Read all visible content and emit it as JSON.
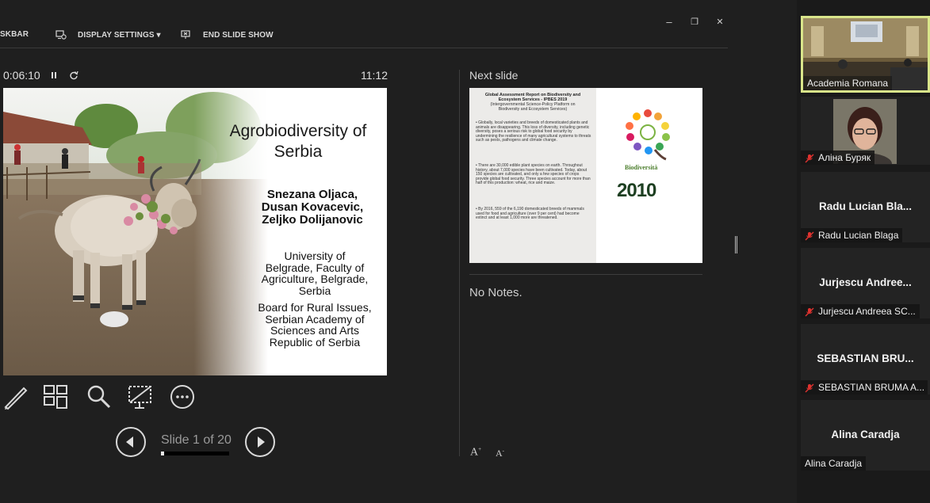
{
  "toolbar": {
    "taskbar_label": "SKBAR",
    "display_settings_label": "DISPLAY SETTINGS ▾",
    "end_slide_show_label": "END SLIDE SHOW"
  },
  "window_controls": {
    "minimize": "–",
    "restore": "❐",
    "close": "✕"
  },
  "presenter": {
    "elapsed_time": "0:06:10",
    "clock": "11:12",
    "current_slide": {
      "title": "Agrobiodiversity of Serbia",
      "authors": "Snezana Oljaca,\nDusan Kovacevic,\nZeljko Dolijanovic",
      "affiliation_1": "University of\nBelgrade, Faculty of\nAgriculture, Belgrade,\nSerbia",
      "affiliation_2": "Board for Rural Issues,\nSerbian Academy of\nSciences and Arts\nRepublic of Serbia"
    },
    "slide_counter": "Slide 1 of 20",
    "progress_fraction": 0.05,
    "next_slide_label": "Next slide",
    "next_slide": {
      "title": "Global Assessment Report on Biodiversity and\nEcosystem Services - IPBES 2019",
      "subtitle": "(Intergovernmental Science-Policy Platform on\nBiodiversity and Ecosystem Services)",
      "bullet_1": "• Globally, local varieties and breeds of domesticated plants and animals are disappearing. This loss of diversity, including genetic diversity, poses a serious risk to global food security by undermining the resilience of many agricultural systems to threats such as pests, pathogens and climate change.",
      "bullet_2": "• There are 30,000 edible plant species on earth. Throughout history, about 7,000 species have been cultivated. Today, about 150 species are cultivated, and only a few species of crops provide global food security. Three species account for more than half of this production: wheat, rice and maize.",
      "bullet_3": "• By 2016, 559 of the 6,190 domesticated breeds of mammals used for food and agriculture (over 9 per cent) had become extinct and at least 1,000 more are threatened.",
      "logo_text": "Biodiversità",
      "logo_2010": "2010"
    },
    "notes": "No Notes.",
    "font_increase": "A",
    "font_decrease": "A"
  },
  "gallery": {
    "colors": {
      "active_border": "#d9e58a",
      "mute_red": "#e0322f"
    },
    "participants": [
      {
        "label": "Academia Romana",
        "big_name": "",
        "muted": false,
        "video": "room"
      },
      {
        "label": "Аліна Буряк",
        "big_name": "",
        "muted": true,
        "video": "face"
      },
      {
        "label": "Radu Lucian Blaga",
        "big_name": "Radu Lucian Bla...",
        "muted": true,
        "video": ""
      },
      {
        "label": "Jurjescu Andreea SC...",
        "big_name": "Jurjescu Andree...",
        "muted": true,
        "video": ""
      },
      {
        "label": "SEBASTIAN BRUMA A...",
        "big_name": "SEBASTIAN BRU...",
        "muted": true,
        "video": ""
      },
      {
        "label": "Alina Caradja",
        "big_name": "Alina Caradja",
        "muted": false,
        "video": ""
      }
    ]
  }
}
